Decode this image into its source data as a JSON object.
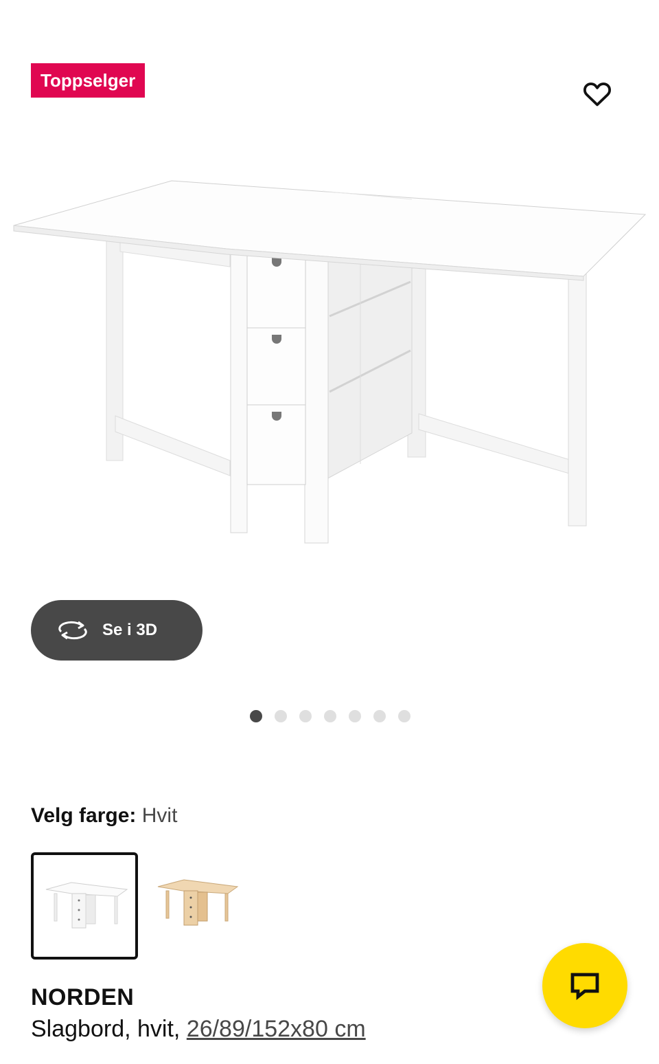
{
  "badge": {
    "text": "Toppselger",
    "color": "#e00751"
  },
  "favorite": {
    "icon": "heart-outline-icon"
  },
  "hero": {
    "subject": "NORDEN gateleg table, white, with drawers"
  },
  "view3d": {
    "label": "Se i 3D",
    "icon": "rotate-3d-icon"
  },
  "carousel": {
    "total": 7,
    "active_index": 0
  },
  "color_picker": {
    "label": "Velg farge:",
    "value": "Hvit",
    "options": [
      {
        "name": "white",
        "selected": true,
        "color": "#ffffff"
      },
      {
        "name": "birch",
        "selected": false,
        "color": "#e8c79a"
      }
    ]
  },
  "product": {
    "name": "NORDEN",
    "description_prefix": "Slagbord, hvit, ",
    "size": "26/89/152x80 cm"
  },
  "chat": {
    "icon": "chat-bubble-icon",
    "color": "#ffdb00"
  }
}
